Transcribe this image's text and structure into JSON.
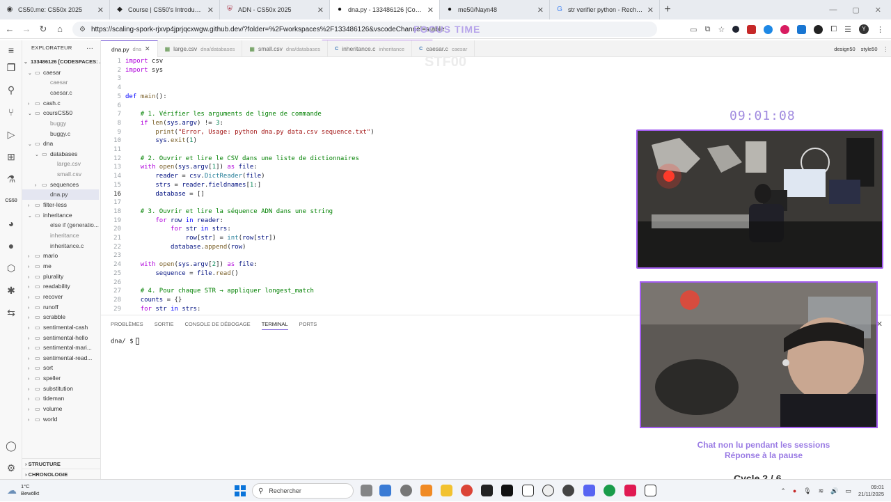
{
  "browser": {
    "tabs": [
      {
        "label": "CS50.me: CS50x 2025",
        "icon": "cs50-icon"
      },
      {
        "label": "Course | CS50's Introduction to",
        "icon": "edx-icon"
      },
      {
        "label": "ADN - CS50x 2025",
        "icon": "harvard-icon"
      },
      {
        "label": "dna.py - 133486126 [Codespac",
        "icon": "github-icon"
      },
      {
        "label": "me50/Nayn48",
        "icon": "github-icon"
      },
      {
        "label": "str verifier python - Recherche",
        "icon": "google-icon"
      }
    ],
    "url": "https://scaling-spork-rjxvp4jprjqcxwgw.github.dev/?folder=%2Fworkspaces%2F133486126&vscodeChannel=stable",
    "avatar": "Y"
  },
  "overlay": {
    "focus_title": "FOCUS TIME",
    "faint_text": "STF00",
    "clock": "09:01:08",
    "chat_line1": "Chat non lu pendant les sessions",
    "chat_line2": "Réponse à la pause",
    "cycle": "Cycle 2 / 6"
  },
  "explorer": {
    "title": "EXPLORATEUR",
    "root": "133486126 [CODESPACES: ...",
    "items": [
      {
        "label": "caesar",
        "type": "folder",
        "open": true,
        "depth": 1
      },
      {
        "label": "caesar",
        "type": "file",
        "depth": 2
      },
      {
        "label": "caesar.c",
        "type": "file-c",
        "depth": 2
      },
      {
        "label": "cash.c",
        "type": "folder",
        "open": false,
        "depth": 1
      },
      {
        "label": "coursCS50",
        "type": "folder",
        "open": true,
        "depth": 1
      },
      {
        "label": "buggy",
        "type": "file",
        "depth": 2
      },
      {
        "label": "buggy.c",
        "type": "file-c",
        "depth": 2
      },
      {
        "label": "dna",
        "type": "folder",
        "open": true,
        "depth": 1
      },
      {
        "label": "databases",
        "type": "folder",
        "open": true,
        "depth": 2
      },
      {
        "label": "large.csv",
        "type": "file",
        "depth": 3
      },
      {
        "label": "small.csv",
        "type": "file",
        "depth": 3
      },
      {
        "label": "sequences",
        "type": "folder",
        "open": false,
        "depth": 2
      },
      {
        "label": "dna.py",
        "type": "file-py",
        "depth": 2,
        "selected": true
      },
      {
        "label": "filter-less",
        "type": "folder",
        "open": false,
        "depth": 1
      },
      {
        "label": "inheritance",
        "type": "folder",
        "open": true,
        "depth": 1
      },
      {
        "label": "else if (generatio...",
        "type": "file-c",
        "depth": 2
      },
      {
        "label": "inheritance",
        "type": "file",
        "depth": 2
      },
      {
        "label": "inheritance.c",
        "type": "file-c",
        "depth": 2
      },
      {
        "label": "mario",
        "type": "folder",
        "open": false,
        "depth": 1
      },
      {
        "label": "me",
        "type": "folder",
        "open": false,
        "depth": 1
      },
      {
        "label": "plurality",
        "type": "folder",
        "open": false,
        "depth": 1
      },
      {
        "label": "readability",
        "type": "folder",
        "open": false,
        "depth": 1
      },
      {
        "label": "recover",
        "type": "folder",
        "open": false,
        "depth": 1
      },
      {
        "label": "runoff",
        "type": "folder",
        "open": false,
        "depth": 1
      },
      {
        "label": "scrabble",
        "type": "folder",
        "open": false,
        "depth": 1
      },
      {
        "label": "sentimental-cash",
        "type": "folder",
        "open": false,
        "depth": 1
      },
      {
        "label": "sentimental-hello",
        "type": "folder",
        "open": false,
        "depth": 1
      },
      {
        "label": "sentimental-mari...",
        "type": "folder",
        "open": false,
        "depth": 1
      },
      {
        "label": "sentimental-read...",
        "type": "folder",
        "open": false,
        "depth": 1
      },
      {
        "label": "sort",
        "type": "folder",
        "open": false,
        "depth": 1
      },
      {
        "label": "speller",
        "type": "folder",
        "open": false,
        "depth": 1
      },
      {
        "label": "substitution",
        "type": "folder",
        "open": false,
        "depth": 1
      },
      {
        "label": "tideman",
        "type": "folder",
        "open": false,
        "depth": 1
      },
      {
        "label": "volume",
        "type": "folder",
        "open": false,
        "depth": 1
      },
      {
        "label": "world",
        "type": "folder",
        "open": false,
        "depth": 1
      }
    ],
    "structure": "STRUCTURE",
    "timeline": "CHRONOLOGIE",
    "activity_cs50": "CS50"
  },
  "editor": {
    "tabs": [
      {
        "name": "dna.py",
        "sub": "dna",
        "active": true,
        "kind": "py"
      },
      {
        "name": "large.csv",
        "sub": "dna/databases",
        "kind": "tbl"
      },
      {
        "name": "small.csv",
        "sub": "dna/databases",
        "kind": "tbl"
      },
      {
        "name": "inheritance.c",
        "sub": "inheritance",
        "kind": "c"
      },
      {
        "name": "caesar.c",
        "sub": "caesar",
        "kind": "c"
      }
    ],
    "actions": [
      "design50",
      "style50"
    ],
    "current_line": 16,
    "lines": [
      [
        [
          "kw2",
          "import"
        ],
        [
          "txt",
          " csv"
        ]
      ],
      [
        [
          "kw2",
          "import"
        ],
        [
          "txt",
          " sys"
        ]
      ],
      [],
      [],
      [
        [
          "kw",
          "def"
        ],
        [
          "txt",
          " "
        ],
        [
          "fn",
          "main"
        ],
        [
          "txt",
          "():"
        ]
      ],
      [],
      [
        [
          "txt",
          "    "
        ],
        [
          "cmt",
          "# 1. Vérifier les arguments de ligne de commande"
        ]
      ],
      [
        [
          "txt",
          "    "
        ],
        [
          "kw2",
          "if"
        ],
        [
          "txt",
          " "
        ],
        [
          "fn",
          "len"
        ],
        [
          "txt",
          "("
        ],
        [
          "var",
          "sys"
        ],
        [
          "txt",
          "."
        ],
        [
          "var",
          "argv"
        ],
        [
          "txt",
          ") != "
        ],
        [
          "num",
          "3"
        ],
        [
          "txt",
          ":"
        ]
      ],
      [
        [
          "txt",
          "        "
        ],
        [
          "fn",
          "print"
        ],
        [
          "txt",
          "("
        ],
        [
          "str",
          "\"Error, Usage: python dna.py data.csv sequence.txt\""
        ],
        [
          "txt",
          ")"
        ]
      ],
      [
        [
          "txt",
          "        "
        ],
        [
          "var",
          "sys"
        ],
        [
          "txt",
          "."
        ],
        [
          "fn",
          "exit"
        ],
        [
          "txt",
          "("
        ],
        [
          "num",
          "1"
        ],
        [
          "txt",
          ")"
        ]
      ],
      [],
      [
        [
          "txt",
          "    "
        ],
        [
          "cmt",
          "# 2. Ouvrir et lire le CSV dans une liste de dictionnaires"
        ]
      ],
      [
        [
          "txt",
          "    "
        ],
        [
          "kw2",
          "with"
        ],
        [
          "txt",
          " "
        ],
        [
          "fn",
          "open"
        ],
        [
          "txt",
          "("
        ],
        [
          "var",
          "sys"
        ],
        [
          "txt",
          "."
        ],
        [
          "var",
          "argv"
        ],
        [
          "txt",
          "["
        ],
        [
          "num",
          "1"
        ],
        [
          "txt",
          "]) "
        ],
        [
          "kw2",
          "as"
        ],
        [
          "txt",
          " "
        ],
        [
          "var",
          "file"
        ],
        [
          "txt",
          ":"
        ]
      ],
      [
        [
          "txt",
          "        "
        ],
        [
          "var",
          "reader"
        ],
        [
          "txt",
          " = "
        ],
        [
          "var",
          "csv"
        ],
        [
          "txt",
          "."
        ],
        [
          "cls",
          "DictReader"
        ],
        [
          "txt",
          "("
        ],
        [
          "var",
          "file"
        ],
        [
          "txt",
          ")"
        ]
      ],
      [
        [
          "txt",
          "        "
        ],
        [
          "var",
          "strs"
        ],
        [
          "txt",
          " = "
        ],
        [
          "var",
          "reader"
        ],
        [
          "txt",
          "."
        ],
        [
          "var",
          "fieldnames"
        ],
        [
          "txt",
          "["
        ],
        [
          "num",
          "1"
        ],
        [
          "txt",
          ":]"
        ]
      ],
      [
        [
          "txt",
          "        "
        ],
        [
          "var",
          "database"
        ],
        [
          "txt",
          " = []"
        ]
      ],
      [],
      [
        [
          "txt",
          "    "
        ],
        [
          "cmt",
          "# 3. Ouvrir et lire la séquence ADN dans une string"
        ]
      ],
      [
        [
          "txt",
          "        "
        ],
        [
          "kw2",
          "for"
        ],
        [
          "txt",
          " "
        ],
        [
          "var",
          "row"
        ],
        [
          "txt",
          " "
        ],
        [
          "kw",
          "in"
        ],
        [
          "txt",
          " "
        ],
        [
          "var",
          "reader"
        ],
        [
          "txt",
          ":"
        ]
      ],
      [
        [
          "txt",
          "            "
        ],
        [
          "kw2",
          "for"
        ],
        [
          "txt",
          " "
        ],
        [
          "var",
          "str"
        ],
        [
          "txt",
          " "
        ],
        [
          "kw",
          "in"
        ],
        [
          "txt",
          " "
        ],
        [
          "var",
          "strs"
        ],
        [
          "txt",
          ":"
        ]
      ],
      [
        [
          "txt",
          "                "
        ],
        [
          "var",
          "row"
        ],
        [
          "txt",
          "["
        ],
        [
          "var",
          "str"
        ],
        [
          "txt",
          "] = "
        ],
        [
          "cls",
          "int"
        ],
        [
          "txt",
          "("
        ],
        [
          "var",
          "row"
        ],
        [
          "txt",
          "["
        ],
        [
          "var",
          "str"
        ],
        [
          "txt",
          "])"
        ]
      ],
      [
        [
          "txt",
          "            "
        ],
        [
          "var",
          "database"
        ],
        [
          "txt",
          "."
        ],
        [
          "fn",
          "append"
        ],
        [
          "txt",
          "("
        ],
        [
          "var",
          "row"
        ],
        [
          "txt",
          ")"
        ]
      ],
      [],
      [
        [
          "txt",
          "    "
        ],
        [
          "kw2",
          "with"
        ],
        [
          "txt",
          " "
        ],
        [
          "fn",
          "open"
        ],
        [
          "txt",
          "("
        ],
        [
          "var",
          "sys"
        ],
        [
          "txt",
          "."
        ],
        [
          "var",
          "argv"
        ],
        [
          "txt",
          "["
        ],
        [
          "num",
          "2"
        ],
        [
          "txt",
          "]) "
        ],
        [
          "kw2",
          "as"
        ],
        [
          "txt",
          " "
        ],
        [
          "var",
          "file"
        ],
        [
          "txt",
          ":"
        ]
      ],
      [
        [
          "txt",
          "        "
        ],
        [
          "var",
          "sequence"
        ],
        [
          "txt",
          " = "
        ],
        [
          "var",
          "file"
        ],
        [
          "txt",
          "."
        ],
        [
          "fn",
          "read"
        ],
        [
          "txt",
          "()"
        ]
      ],
      [],
      [
        [
          "txt",
          "    "
        ],
        [
          "cmt",
          "# 4. Pour chaque STR → appliquer longest_match"
        ]
      ],
      [
        [
          "txt",
          "    "
        ],
        [
          "var",
          "counts"
        ],
        [
          "txt",
          " = {}"
        ]
      ],
      [
        [
          "txt",
          "    "
        ],
        [
          "kw2",
          "for"
        ],
        [
          "txt",
          " "
        ],
        [
          "var",
          "str"
        ],
        [
          "txt",
          " "
        ],
        [
          "kw",
          "in"
        ],
        [
          "txt",
          " "
        ],
        [
          "var",
          "strs"
        ],
        [
          "txt",
          ":"
        ]
      ]
    ]
  },
  "panel": {
    "tabs": [
      "PROBLÈMES",
      "SORTIE",
      "CONSOLE DE DÉBOGAGE",
      "TERMINAL",
      "PORTS"
    ],
    "active_tab": "TERMINAL",
    "prompt": "dna/ $"
  },
  "taskbar": {
    "temp": "1°C",
    "weather": "Bewölkt",
    "search_placeholder": "Rechercher",
    "time": "09:01",
    "date": "21/11/2025"
  }
}
